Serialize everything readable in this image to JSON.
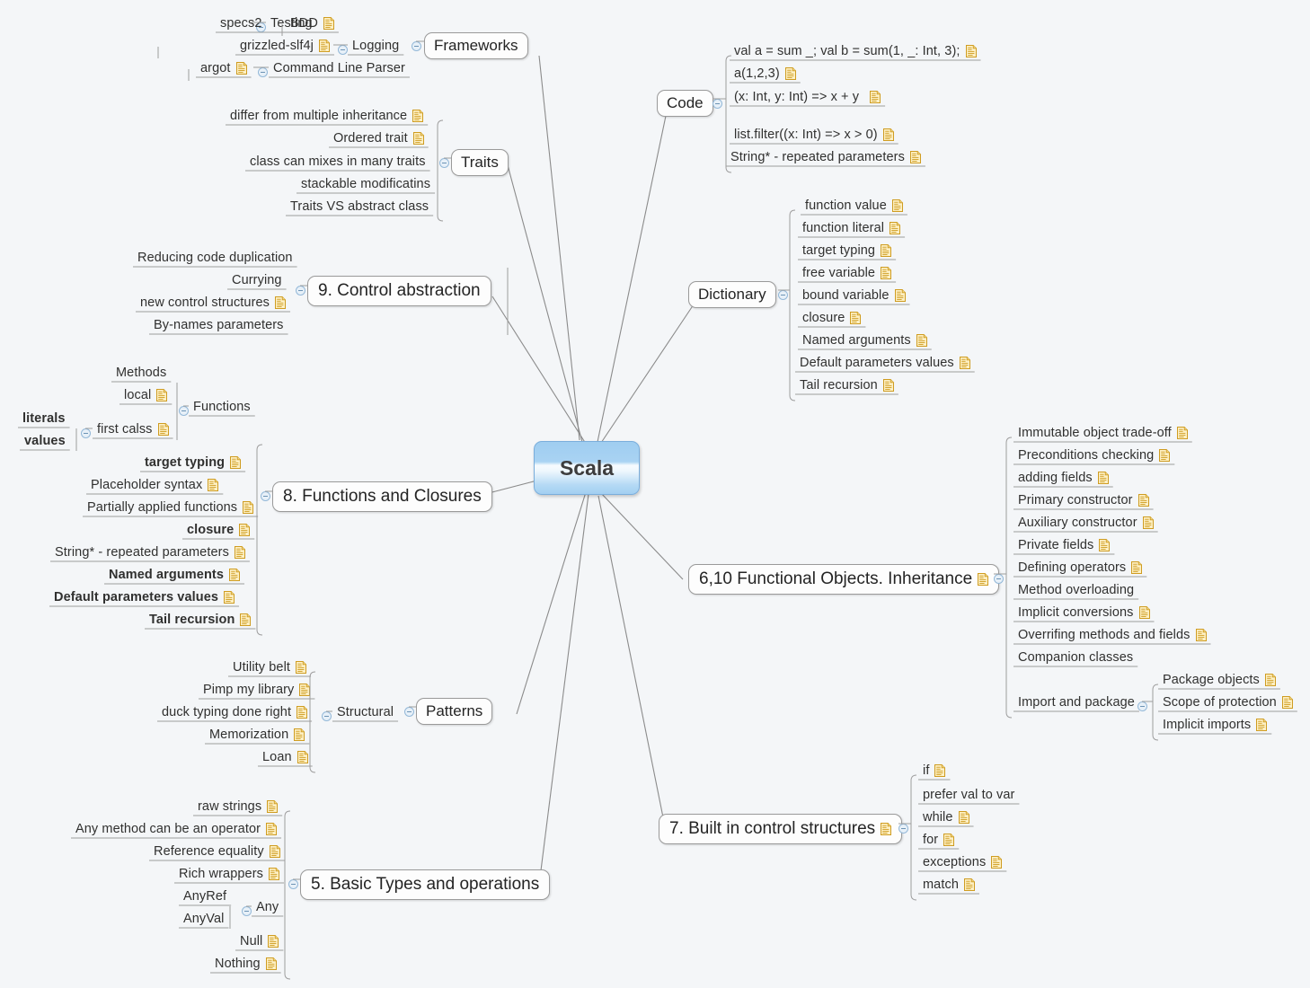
{
  "root": {
    "label": "Scala"
  },
  "icons": {
    "note": "note-icon",
    "toggle": "collapse-toggle-icon"
  },
  "colors": {
    "root_border": "#7aaedc",
    "root_fill_top": "#9fcdf0",
    "root_fill_mid": "#f7fbfe",
    "node_border": "#9a9a9a",
    "node_fill": "#fdfdfd",
    "note_icon": "#e8b84b",
    "link_line": "#8b8b8b",
    "background": "#f4f6f8"
  },
  "branches": {
    "frameworks": {
      "label": "Frameworks",
      "children": [
        {
          "label": "Testing",
          "grandchildren": [
            {
              "label": "specs2",
              "note": false
            },
            {
              "label": "BDD",
              "note": true
            }
          ]
        },
        {
          "label": "Logging",
          "grandchildren": [
            {
              "label": "grizzled-slf4j",
              "note": true
            }
          ]
        },
        {
          "label": "Command Line Parser",
          "grandchildren": [
            {
              "label": "argot",
              "note": true
            }
          ]
        }
      ]
    },
    "traits": {
      "label": "Traits",
      "children": [
        {
          "label": "differ from multiple inheritance",
          "note": true
        },
        {
          "label": "Ordered trait",
          "note": true
        },
        {
          "label": "class can mixes in many traits",
          "note": false
        },
        {
          "label": "stackable modificatins",
          "note": false
        },
        {
          "label": "Traits VS abstract class",
          "note": false
        }
      ]
    },
    "control_abstraction": {
      "label": "9. Control abstraction",
      "children": [
        {
          "label": "Reducing code duplication",
          "note": false
        },
        {
          "label": "Currying",
          "note": false
        },
        {
          "label": "new control structures",
          "note": true
        },
        {
          "label": "By-names parameters",
          "note": false
        }
      ]
    },
    "functions_and_closures": {
      "label": "8. Functions and Closures",
      "children": [
        {
          "label": "Functions",
          "note": false,
          "grandchildren": [
            {
              "label": "Methods",
              "note": false
            },
            {
              "label": "local",
              "note": true
            },
            {
              "label": "first calss",
              "note": true,
              "greatgrandchildren": [
                {
                  "label": "literals",
                  "note": false,
                  "bold": true
                },
                {
                  "label": "values",
                  "note": false,
                  "bold": true
                }
              ]
            }
          ]
        },
        {
          "label": "target typing",
          "note": true,
          "bold": true
        },
        {
          "label": "Placeholder syntax",
          "note": true,
          "bold": false
        },
        {
          "label": "Partially applied functions",
          "note": true,
          "bold": false
        },
        {
          "label": "closure",
          "note": true,
          "bold": true
        },
        {
          "label": "String* - repeated parameters",
          "note": true,
          "bold": false
        },
        {
          "label": "Named arguments",
          "note": true,
          "bold": true
        },
        {
          "label": "Default parameters values",
          "note": true,
          "bold": true
        },
        {
          "label": "Tail recursion",
          "note": true,
          "bold": true
        }
      ]
    },
    "patterns": {
      "label": "Patterns",
      "children": [
        {
          "label": "Structural",
          "note": false,
          "grandchildren": [
            {
              "label": "Utility belt",
              "note": true
            },
            {
              "label": "Pimp my library",
              "note": true
            },
            {
              "label": "duck typing done right",
              "note": true
            },
            {
              "label": "Memorization",
              "note": true
            },
            {
              "label": "Loan",
              "note": true
            }
          ]
        }
      ]
    },
    "basic_types": {
      "label": "5. Basic Types and operations",
      "children": [
        {
          "label": "raw strings",
          "note": true
        },
        {
          "label": "Any method can be an operator",
          "note": true
        },
        {
          "label": "Reference equality",
          "note": true
        },
        {
          "label": "Rich wrappers",
          "note": true
        },
        {
          "label": "Any",
          "note": false,
          "grandchildren": [
            {
              "label": "AnyRef",
              "note": false
            },
            {
              "label": "AnyVal",
              "note": false
            }
          ]
        },
        {
          "label": "Null",
          "note": true
        },
        {
          "label": "Nothing",
          "note": true
        }
      ]
    },
    "code": {
      "label": "Code",
      "children": [
        {
          "label": "val a = sum _; val b = sum(1, _: Int, 3);",
          "note": true
        },
        {
          "label": "a(1,2,3)",
          "note": true
        },
        {
          "label": "(x: Int, y: Int) => x + y",
          "note": true
        },
        {
          "label": "list.filter((x: Int) => x > 0)",
          "note": true
        },
        {
          "label": "String* - repeated parameters",
          "note": true
        }
      ]
    },
    "dictionary": {
      "label": "Dictionary",
      "children": [
        {
          "label": "function value",
          "note": true
        },
        {
          "label": "function literal",
          "note": true
        },
        {
          "label": "target typing",
          "note": true
        },
        {
          "label": "free variable",
          "note": true
        },
        {
          "label": "bound variable",
          "note": true
        },
        {
          "label": "closure",
          "note": true
        },
        {
          "label": "Named arguments",
          "note": true
        },
        {
          "label": "Default parameters values",
          "note": true
        },
        {
          "label": "Tail recursion",
          "note": true
        }
      ]
    },
    "functional_objects": {
      "label": "6,10 Functional Objects. Inheritance",
      "note": true,
      "children": [
        {
          "label": "Immutable object trade-off",
          "note": true
        },
        {
          "label": "Preconditions checking",
          "note": true
        },
        {
          "label": "adding fields",
          "note": true
        },
        {
          "label": "Primary constructor",
          "note": true
        },
        {
          "label": "Auxiliary constructor",
          "note": true
        },
        {
          "label": "Private fields",
          "note": true
        },
        {
          "label": "Defining operators",
          "note": true
        },
        {
          "label": "Method overloading",
          "note": false
        },
        {
          "label": "Implicit conversions",
          "note": true
        },
        {
          "label": "Overrifing methods and fields",
          "note": true
        },
        {
          "label": "Companion classes",
          "note": false
        },
        {
          "label": "Import and package",
          "note": false,
          "grandchildren": [
            {
              "label": "Package objects",
              "note": true
            },
            {
              "label": "Scope of protection",
              "note": true
            },
            {
              "label": "Implicit imports",
              "note": true
            }
          ]
        }
      ]
    },
    "control_structures": {
      "label": "7. Built in control structures",
      "note": true,
      "children": [
        {
          "label": "if",
          "note": true
        },
        {
          "label": "prefer val to var",
          "note": false
        },
        {
          "label": "while",
          "note": true
        },
        {
          "label": "for",
          "note": true
        },
        {
          "label": "exceptions",
          "note": true
        },
        {
          "label": "match",
          "note": true
        }
      ]
    }
  }
}
